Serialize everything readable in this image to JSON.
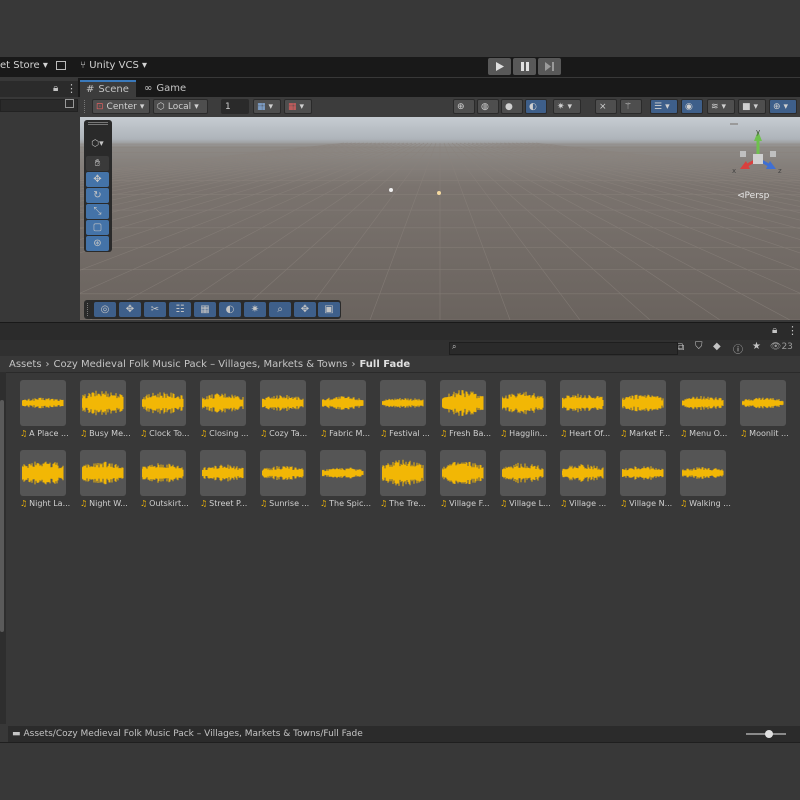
{
  "toolbar": {
    "asset_store": "et Store",
    "vcs": "Unity VCS"
  },
  "tabs": [
    {
      "label": "Scene"
    },
    {
      "label": "Game"
    }
  ],
  "scene_toolbar": {
    "pivot": "Center",
    "space": "Local",
    "snap_value": "1"
  },
  "gizmo": {
    "persp": "Persp",
    "x": "x",
    "y": "y",
    "z": "z"
  },
  "project": {
    "count": "23",
    "breadcrumb": [
      "Assets",
      "Cozy Medieval Folk Music Pack – Villages, Markets & Towns",
      "Full Fade"
    ],
    "status_path": "Assets/Cozy Medieval Folk Music Pack – Villages, Markets & Towns/Full Fade",
    "assets": [
      {
        "name": "A Place ..."
      },
      {
        "name": "Busy Me..."
      },
      {
        "name": "Clock To..."
      },
      {
        "name": "Closing ..."
      },
      {
        "name": "Cozy Ta..."
      },
      {
        "name": "Fabric M..."
      },
      {
        "name": "Festival ..."
      },
      {
        "name": "Fresh Ba..."
      },
      {
        "name": "Hagglin..."
      },
      {
        "name": "Heart Of..."
      },
      {
        "name": "Market F..."
      },
      {
        "name": "Menu O..."
      },
      {
        "name": "Moonlit ..."
      },
      {
        "name": "Night La..."
      },
      {
        "name": "Night W..."
      },
      {
        "name": "Outskirt..."
      },
      {
        "name": "Street P..."
      },
      {
        "name": "Sunrise ..."
      },
      {
        "name": "The Spic..."
      },
      {
        "name": "The Tre..."
      },
      {
        "name": "Village F..."
      },
      {
        "name": "Village L..."
      },
      {
        "name": "Village ..."
      },
      {
        "name": "Village N..."
      },
      {
        "name": "Walking ..."
      }
    ]
  },
  "colors": {
    "waveform": "#f2b705",
    "accent": "#3a79bb"
  }
}
